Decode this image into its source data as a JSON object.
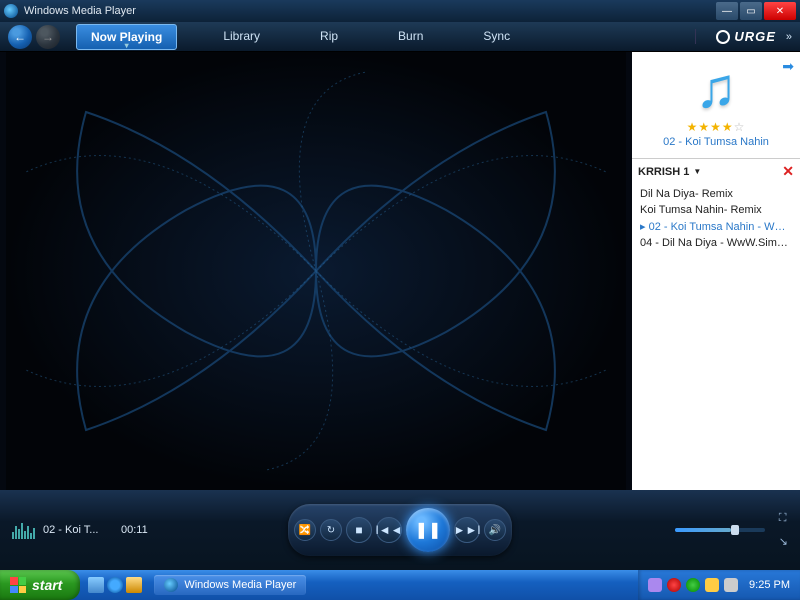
{
  "window": {
    "title": "Windows Media Player"
  },
  "nav": {
    "tabs": [
      {
        "label": "Now Playing",
        "active": true
      },
      {
        "label": "Library"
      },
      {
        "label": "Rip"
      },
      {
        "label": "Burn"
      },
      {
        "label": "Sync"
      }
    ],
    "brand": "URGE"
  },
  "side": {
    "rating_full": "★★★★",
    "rating_empty": "☆",
    "current_title": "02 - Koi Tumsa Nahin",
    "playlist_name": "KRRISH 1",
    "items": [
      {
        "label": "Dil Na Diya- Remix"
      },
      {
        "label": "Koi Tumsa Nahin- Remix"
      },
      {
        "label": "02 - Koi Tumsa Nahin - WwW....",
        "current": true
      },
      {
        "label": "04 - Dil Na Diya - WwW.SimPL...."
      }
    ]
  },
  "controls": {
    "track_display": "02 - Koi T...",
    "elapsed": "00:11",
    "volume_pct": 62
  },
  "taskbar": {
    "start": "start",
    "app": "Windows Media Player",
    "clock": "9:25 PM"
  }
}
